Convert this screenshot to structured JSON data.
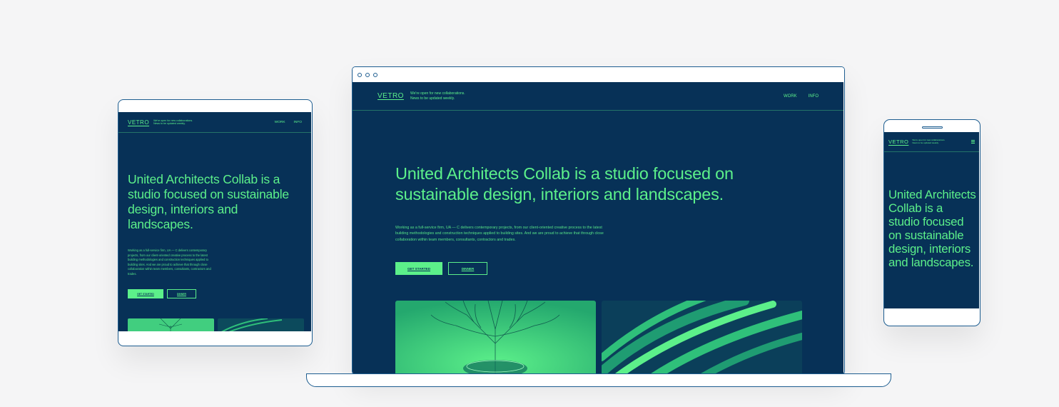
{
  "site": {
    "logo": "VETRO",
    "tagline_line1": "We're open for new collaborations.",
    "tagline_line2": "News to be updated weekly.",
    "nav": [
      "WORK",
      "INFO"
    ],
    "headline": "United Architects Collab is a studio focused on sustainable design, interiors and landscapes.",
    "body": "Working as a full-service firm, UA — C delivers contemporary projects, from our client-oriented creative process to the latest building methodologies and construction techniques applied to building sites. And we are proud to achieve that through close collaboration within team members, consultants, contractors and trades.",
    "primary_button": "GET STARTED",
    "secondary_button": "DINNER"
  },
  "colors": {
    "background": "#f5f5f6",
    "site_bg": "#073157",
    "accent": "#5cf08a",
    "device_outline": "#1d5d90"
  },
  "icons": {
    "browser_dots": "window-control-dots",
    "phone_menu": "hamburger-menu-icon"
  }
}
